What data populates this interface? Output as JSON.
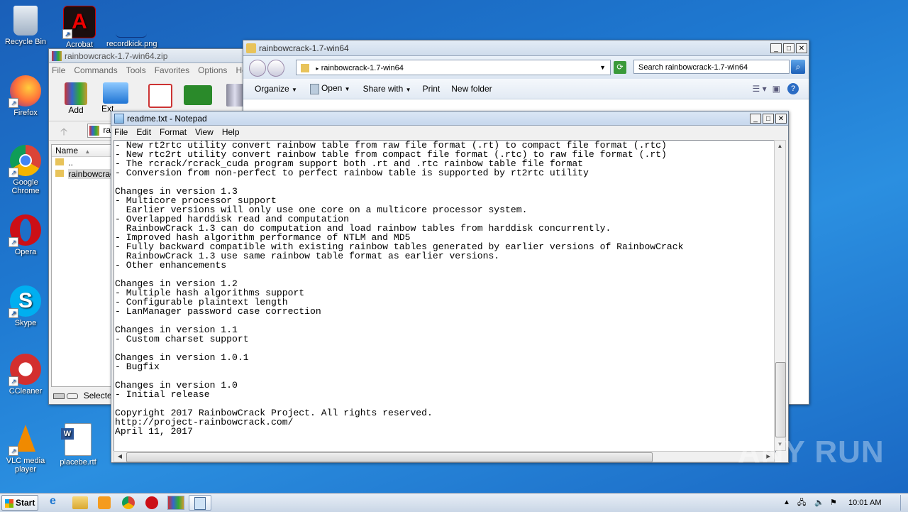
{
  "desktop": {
    "icons": [
      {
        "label": "Recycle Bin",
        "icon": "recycle-bin-icon"
      },
      {
        "label": "Acrobat",
        "icon": "acrobat-icon"
      },
      {
        "label": "recordkick.png",
        "icon": "image-file-icon"
      },
      {
        "label": "Firefox",
        "icon": "firefox-icon"
      },
      {
        "label": "Google Chrome",
        "icon": "chrome-icon"
      },
      {
        "label": "Opera",
        "icon": "opera-icon"
      },
      {
        "label": "Skype",
        "icon": "skype-icon"
      },
      {
        "label": "CCleaner",
        "icon": "ccleaner-icon"
      },
      {
        "label": "VLC media player",
        "icon": "vlc-icon"
      },
      {
        "label": "placebe.rtf",
        "icon": "word-doc-icon"
      }
    ]
  },
  "winrar": {
    "title": "rainbowcrack-1.7-win64.zip",
    "menu": [
      "File",
      "Commands",
      "Tools",
      "Favorites",
      "Options",
      "Help"
    ],
    "toolbar": [
      "Add",
      "Ext"
    ],
    "path_partial": "ra",
    "column_name": "Name",
    "rows": [
      "..",
      "rainbowcrack"
    ],
    "status": "Selected"
  },
  "explorer": {
    "title": "rainbowcrack-1.7-win64",
    "address": "rainbowcrack-1.7-win64",
    "search_placeholder": "Search rainbowcrack-1.7-win64",
    "toolbar": [
      "Organize",
      "Open",
      "Share with",
      "Print",
      "New folder"
    ]
  },
  "notepad": {
    "title": "readme.txt - Notepad",
    "menu": [
      "File",
      "Edit",
      "Format",
      "View",
      "Help"
    ],
    "lines": [
      "- New rt2rtc utility convert rainbow table from raw file format (.rt) to compact file format (.rtc)",
      "- New rtc2rt utility convert rainbow table from compact file format (.rtc) to raw file format (.rt)",
      "- The rcrack/rcrack_cuda program support both .rt and .rtc rainbow table file format",
      "- Conversion from non-perfect to perfect rainbow table is supported by rt2rtc utility",
      "",
      "Changes in version 1.3",
      "- Multicore processor support",
      "  Earlier versions will only use one core on a multicore processor system.",
      "- Overlapped harddisk read and computation",
      "  RainbowCrack 1.3 can do computation and load rainbow tables from harddisk concurrently.",
      "- Improved hash algorithm performance of NTLM and MD5",
      "- Fully backward compatible with existing rainbow tables generated by earlier versions of RainbowCrack",
      "  RainbowCrack 1.3 use same rainbow table format as earlier versions.",
      "- Other enhancements",
      "",
      "Changes in version 1.2",
      "- Multiple hash algorithms support",
      "- Configurable plaintext length",
      "- LanManager password case correction",
      "",
      "Changes in version 1.1",
      "- Custom charset support",
      "",
      "Changes in version 1.0.1",
      "- Bugfix",
      "",
      "Changes in version 1.0",
      "- Initial release",
      "",
      "Copyright 2017 RainbowCrack Project. All rights reserved.",
      "http://project-rainbowcrack.com/",
      "April 11, 2017"
    ]
  },
  "taskbar": {
    "start_label": "Start",
    "clock": "10:01 AM"
  },
  "watermark": "ANY RUN"
}
